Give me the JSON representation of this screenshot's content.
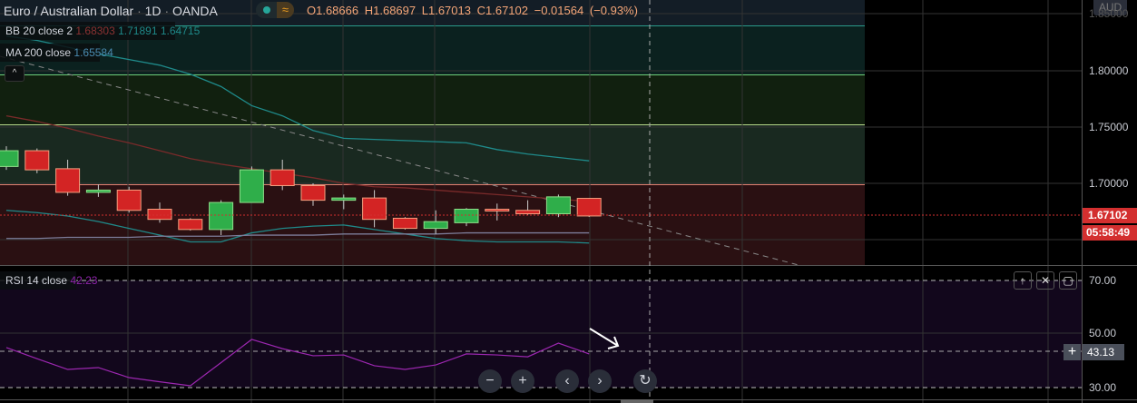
{
  "header": {
    "symbol": "Euro / Australian Dollar",
    "interval": "1D",
    "exchange": "OANDA",
    "separator": "·",
    "ohlc": {
      "open": "O1.68666",
      "high": "H1.68697",
      "low": "L1.67013",
      "close": "C1.67102",
      "change": "−0.01564 (−0.93%)"
    }
  },
  "indicators": {
    "bb": {
      "label": "BB 20 close 2",
      "basis": "1.68303",
      "upper": "1.71891",
      "lower": "1.64715"
    },
    "ma": {
      "label": "MA 200 close",
      "value": "1.65584"
    },
    "rsi": {
      "label": "RSI 14 close",
      "value": "42.23"
    }
  },
  "price_axis": {
    "currency": "AUD",
    "ticks": [
      "1.85000",
      "1.80000",
      "1.75000",
      "1.70000"
    ],
    "last_price": "1.67102",
    "countdown": "05:58:49"
  },
  "rsi_axis": {
    "ticks": [
      "70.00",
      "50.00",
      "30.00"
    ],
    "crosshair_value": "43.13"
  },
  "colors": {
    "up": "#2fae4a",
    "down": "#d32424",
    "bb": "#1f8a8a",
    "basis": "#7a2a2a",
    "ma": "#7d7d9a",
    "rsi": "#9c27b0",
    "last": "#d32f2f"
  },
  "chart_data": {
    "type": "candlestick",
    "candles": [
      [
        1.715,
        1.733,
        1.712,
        1.729
      ],
      [
        1.729,
        1.731,
        1.709,
        1.712
      ],
      [
        1.713,
        1.721,
        1.689,
        1.692
      ],
      [
        1.692,
        1.699,
        1.688,
        1.694
      ],
      [
        1.694,
        1.697,
        1.674,
        1.676
      ],
      [
        1.677,
        1.683,
        1.665,
        1.668
      ],
      [
        1.668,
        1.669,
        1.658,
        1.659
      ],
      [
        1.659,
        1.685,
        1.654,
        1.683
      ],
      [
        1.683,
        1.715,
        1.683,
        1.712
      ],
      [
        1.712,
        1.721,
        1.694,
        1.698
      ],
      [
        1.698,
        1.7,
        1.68,
        1.685
      ],
      [
        1.685,
        1.69,
        1.677,
        1.687
      ],
      [
        1.687,
        1.694,
        1.661,
        1.668
      ],
      [
        1.669,
        1.67,
        1.659,
        1.66
      ],
      [
        1.66,
        1.676,
        1.655,
        1.666
      ],
      [
        1.665,
        1.678,
        1.662,
        1.677
      ],
      [
        1.677,
        1.682,
        1.667,
        1.676
      ],
      [
        1.676,
        1.685,
        1.672,
        1.673
      ],
      [
        1.673,
        1.69,
        1.67,
        1.688
      ],
      [
        1.68666,
        1.68697,
        1.67013,
        1.67102
      ]
    ],
    "bb_upper": [
      1.831,
      1.827,
      1.821,
      1.815,
      1.81,
      1.805,
      1.797,
      1.786,
      1.769,
      1.76,
      1.747,
      1.74,
      1.739,
      1.738,
      1.737,
      1.736,
      1.73,
      1.726,
      1.723,
      1.72
    ],
    "bb_lower": [
      1.676,
      1.674,
      1.671,
      1.666,
      1.66,
      1.654,
      1.648,
      1.648,
      1.656,
      1.66,
      1.662,
      1.663,
      1.659,
      1.655,
      1.651,
      1.649,
      1.648,
      1.648,
      1.648,
      1.647
    ],
    "bb_basis": [
      1.76,
      1.755,
      1.749,
      1.742,
      1.736,
      1.729,
      1.722,
      1.717,
      1.713,
      1.709,
      1.705,
      1.7,
      1.697,
      1.696,
      1.694,
      1.692,
      1.69,
      1.688,
      1.686,
      1.684
    ],
    "ma200": [
      1.651,
      1.651,
      1.652,
      1.652,
      1.652,
      1.653,
      1.653,
      1.653,
      1.654,
      1.654,
      1.654,
      1.655,
      1.655,
      1.655,
      1.655,
      1.656,
      1.656,
      1.656,
      1.656,
      1.656
    ],
    "rsi": [
      44.5,
      40.3,
      36.2,
      36.9,
      33.1,
      31.5,
      30.0,
      38.8,
      47.6,
      44.1,
      41.4,
      41.7,
      37.6,
      36.2,
      37.9,
      42.1,
      41.7,
      41.0,
      46.2,
      42.1
    ],
    "ylim": [
      1.645,
      1.865
    ],
    "rsi_ylim": [
      25,
      75
    ]
  },
  "nav": {
    "zoom_out": "−",
    "zoom_in": "+",
    "left": "‹",
    "right": "›",
    "reset": "↻"
  },
  "pane_buttons": {
    "up": "↑",
    "close": "✕",
    "maximize": "▢"
  },
  "crosshair_add": "+"
}
